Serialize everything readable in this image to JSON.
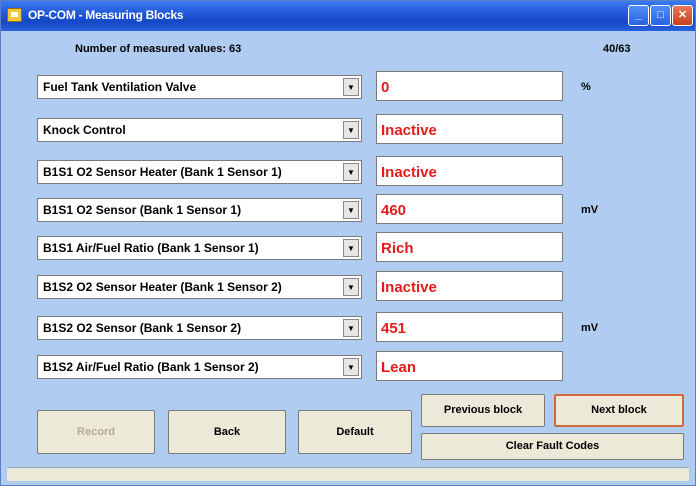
{
  "window": {
    "title": "OP-COM - Measuring Blocks",
    "controls": {
      "minimize": "_",
      "maximize": "□",
      "close": "✕"
    }
  },
  "header": {
    "count_label": "Number of measured values: 63",
    "page_indicator": "40/63"
  },
  "rows": [
    {
      "parameter": "Fuel Tank Ventilation Valve",
      "value": "0",
      "unit": "%"
    },
    {
      "parameter": "Knock Control",
      "value": "Inactive",
      "unit": ""
    },
    {
      "parameter": "B1S1 O2 Sensor Heater (Bank 1 Sensor 1)",
      "value": "Inactive",
      "unit": ""
    },
    {
      "parameter": "B1S1 O2 Sensor (Bank 1 Sensor 1)",
      "value": "460",
      "unit": "mV"
    },
    {
      "parameter": "B1S1 Air/Fuel Ratio (Bank 1 Sensor 1)",
      "value": "Rich",
      "unit": ""
    },
    {
      "parameter": "B1S2 O2 Sensor Heater (Bank 1 Sensor 2)",
      "value": "Inactive",
      "unit": ""
    },
    {
      "parameter": "B1S2 O2 Sensor (Bank 1 Sensor 2)",
      "value": "451",
      "unit": "mV"
    },
    {
      "parameter": "B1S2 Air/Fuel Ratio (Bank 1 Sensor 2)",
      "value": "Lean",
      "unit": ""
    }
  ],
  "buttons": {
    "record": "Record",
    "back": "Back",
    "default": "Default",
    "previous_block": "Previous block",
    "next_block": "Next block",
    "clear_fault_codes": "Clear Fault Codes"
  },
  "colors": {
    "value_text": "#e41b1b",
    "window_bg": "#b0ccf0",
    "titlebar": "#1f55d6"
  }
}
